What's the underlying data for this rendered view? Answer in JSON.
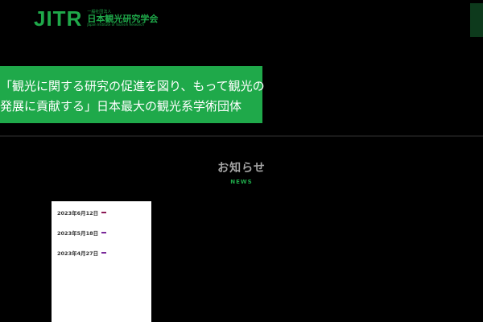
{
  "header": {
    "logo_mark": "JITR",
    "org_type": "一般社団法人",
    "org_name": "日本観光研究学会",
    "org_name_en": "Japan Institute of Tourism Research",
    "side_tab": ""
  },
  "nav": {
    "items": [
      {
        "label": ""
      },
      {
        "label": ""
      },
      {
        "label": ""
      },
      {
        "label": ""
      },
      {
        "label": ""
      },
      {
        "label": ""
      }
    ]
  },
  "hero": {
    "line1": "「観光に関する研究の促進を図り、もって観光の",
    "line2": "発展に貢献する」日本最大の観光系学術団体"
  },
  "section": {
    "title": "お知らせ",
    "subtitle": "NEWS"
  },
  "news": {
    "items": [
      {
        "date": "2023年6月12日",
        "category": "",
        "category_color": "#8c1a55",
        "title": ""
      },
      {
        "date": "2023年5月18日",
        "category": "",
        "category_color": "#7a2a9a",
        "title": ""
      },
      {
        "date": "2023年4月27日",
        "category": "",
        "category_color": "#7a2a9a",
        "title": ""
      }
    ]
  },
  "colors": {
    "brand_green": "#1fa94a",
    "background": "#000000",
    "card_bg": "#ffffff"
  }
}
